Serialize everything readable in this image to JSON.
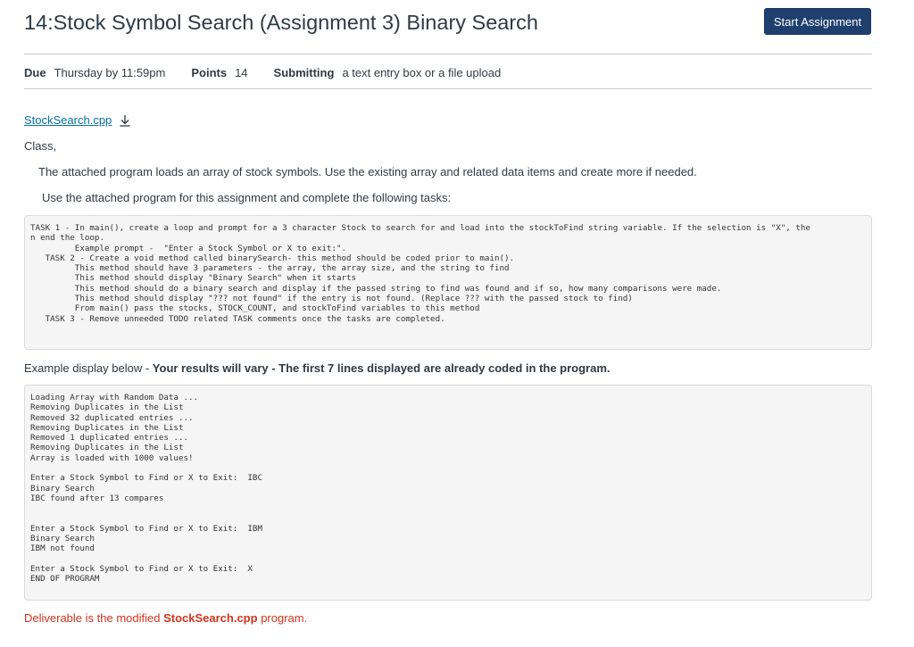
{
  "header": {
    "title": "14:Stock Symbol Search (Assignment 3) Binary Search",
    "start_button": "Start Assignment"
  },
  "details": {
    "due_label": "Due",
    "due_value": "Thursday by 11:59pm",
    "points_label": "Points",
    "points_value": "14",
    "submitting_label": "Submitting",
    "submitting_value": "a text entry box or a file upload"
  },
  "attachment": {
    "file_name": "StockSearch.cpp",
    "icon": "download-icon"
  },
  "body": {
    "greeting": "Class,",
    "intro": "The attached program loads an array of stock symbols. Use the existing array and related data items and create more if needed.",
    "instructions": "Use the attached program for this assignment and complete the following tasks:",
    "tasks_code": "TASK 1 - In main(), create a loop and prompt for a 3 character Stock to search for and load into the stockToFind string variable. If the selection is \"X\", the\nn end the loop.\n         Example prompt -  \"Enter a Stock Symbol or X to exit:\".\n   TASK 2 - Create a void method called binarySearch- this method should be coded prior to main().\n         This method should have 3 parameters - the array, the array size, and the string to find\n         This method should display \"Binary Search\" when it starts\n         This method should do a binary search and display if the passed string to find was found and if so, how many comparisons were made.\n         This method should display \"??? not found\" if the entry is not found. (Replace ??? with the passed stock to find)\n         From main() pass the stocks, STOCK_COUNT, and stockToFind variables to this method\n   TASK 3 - Remove unneeded TODO related TASK comments once the tasks are completed.",
    "example_label": "Example display below - ",
    "example_note": "Your results will vary - The first 7 lines displayed are already coded in the program.",
    "output_code": "Loading Array with Random Data ...\nRemoving Duplicates in the List\nRemoved 32 duplicated entries ...\nRemoving Duplicates in the List\nRemoved 1 duplicated entries ...\nRemoving Duplicates in the List\nArray is loaded with 1000 values!\n\nEnter a Stock Symbol to Find or X to Exit:  IBC\nBinary Search\nIBC found after 13 compares\n\n\nEnter a Stock Symbol to Find or X to Exit:  IBM\nBinary Search\nIBM not found\n\nEnter a Stock Symbol to Find or X to Exit:  X\nEND OF PROGRAM",
    "deliverable_prefix": "Deliverable is the modified ",
    "deliverable_file": "StockSearch.cpp",
    "deliverable_suffix": " program."
  },
  "colors": {
    "primary_button": "#1f3f6e",
    "link": "#0770a3",
    "deliverable_red": "#d0341d",
    "text": "#2d3b45",
    "code_bg": "#f5f5f5"
  }
}
